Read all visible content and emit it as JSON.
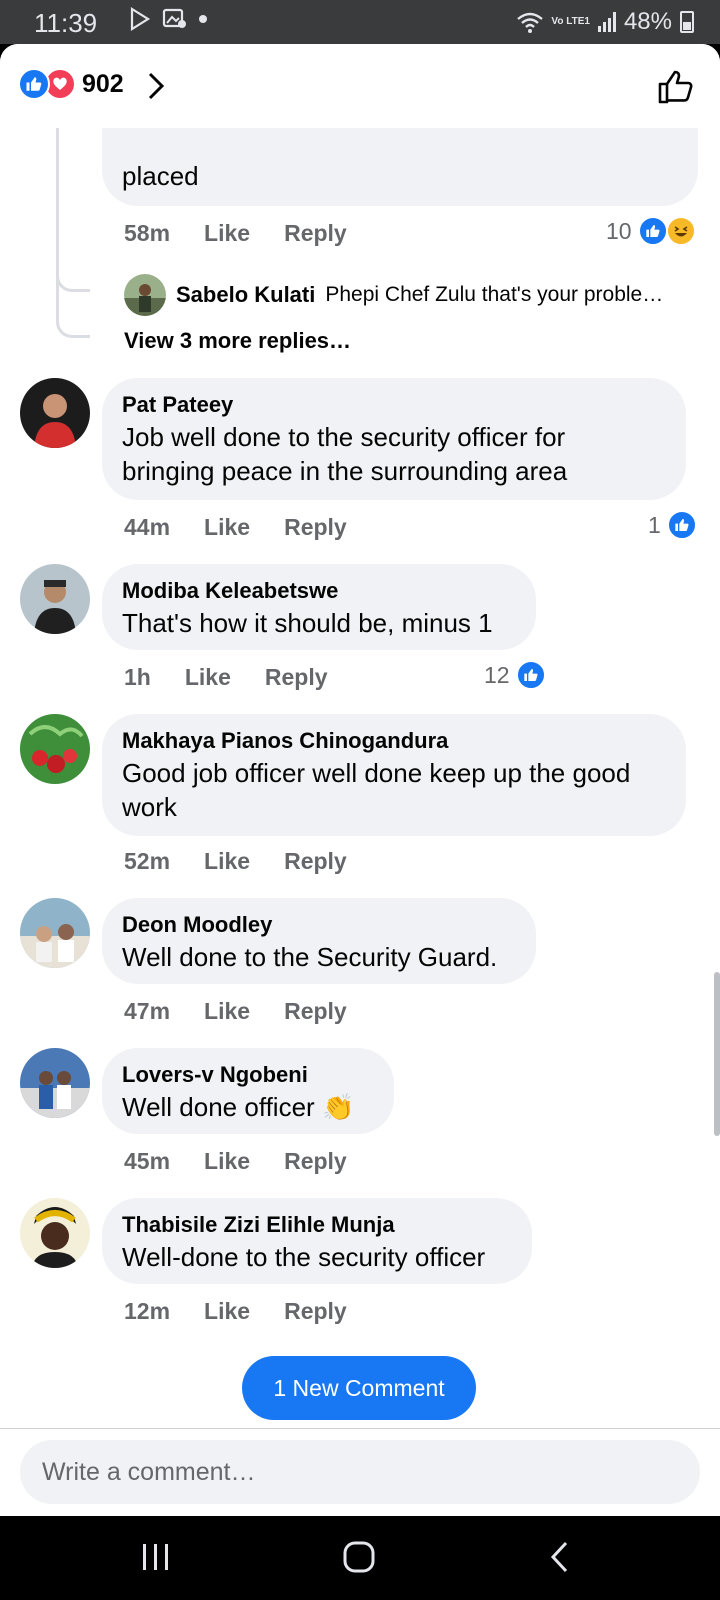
{
  "status_bar": {
    "time": "11:39",
    "signal_label": "Vo LTE1",
    "battery": "48%"
  },
  "header": {
    "reaction_count": "902",
    "reaction_types": [
      "like",
      "love"
    ]
  },
  "top_comment_tail": {
    "text_tail": "placed",
    "time": "58m",
    "like_label": "Like",
    "reply_label": "Reply",
    "reaction_count": "10",
    "reply_preview": {
      "name": "Sabelo Kulati",
      "text": "Phepi Chef Zulu that's your proble…"
    },
    "view_more": "View 3 more replies…"
  },
  "comments": [
    {
      "name": "Pat Pateey",
      "text_lines": [
        "Job well done to the security officer for",
        "bringing peace  in the surrounding area"
      ],
      "time": "44m",
      "like_label": "Like",
      "reply_label": "Reply",
      "reactions": "1"
    },
    {
      "name": "Modiba Keleabetswe",
      "text_lines": [
        "That's how it should be, minus 1"
      ],
      "time": "1h",
      "like_label": "Like",
      "reply_label": "Reply",
      "reactions": "12"
    },
    {
      "name": "Makhaya Pianos Chinogandura",
      "text_lines": [
        "Good job officer well done keep up the good",
        "work"
      ],
      "time": "52m",
      "like_label": "Like",
      "reply_label": "Reply"
    },
    {
      "name": "Deon Moodley",
      "text_lines": [
        "Well done to the Security Guard."
      ],
      "time": "47m",
      "like_label": "Like",
      "reply_label": "Reply"
    },
    {
      "name": "Lovers-v Ngobeni",
      "text_lines": [
        "Well done officer"
      ],
      "emoji": "👏",
      "time": "45m",
      "like_label": "Like",
      "reply_label": "Reply"
    },
    {
      "name": "Thabisile Zizi Elihle Munja",
      "text_lines": [
        "Well-done to the security officer"
      ],
      "time": "12m",
      "like_label": "Like",
      "reply_label": "Reply"
    }
  ],
  "new_comment_button": "1 New Comment",
  "composer": {
    "placeholder": "Write a comment…"
  },
  "colors": {
    "accent": "#1877f2",
    "love": "#f33e58",
    "bubble": "#f0f2f5",
    "meta": "#65676b"
  }
}
